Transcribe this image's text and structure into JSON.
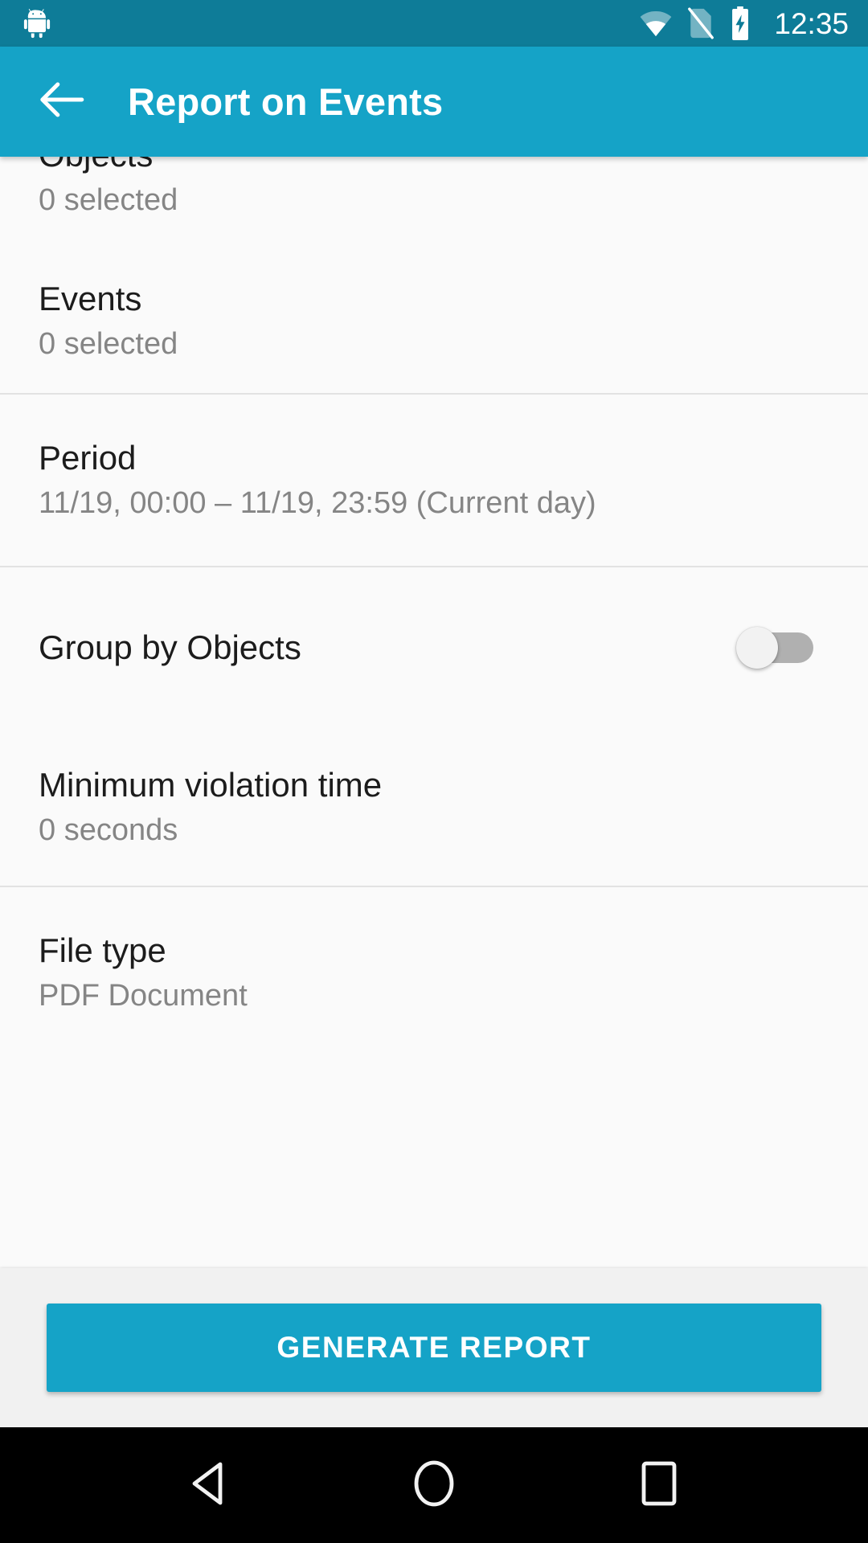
{
  "status_bar": {
    "notification_icon": "android-robot-icon",
    "icons": [
      "wifi-icon",
      "no-sim-card-icon",
      "battery-charging-icon"
    ],
    "time": "12:35",
    "background_color": "#0e7c98"
  },
  "app_bar": {
    "back_icon": "arrow-left-icon",
    "title": "Report on Events",
    "background_color": "#15a3c7"
  },
  "settings_rows": [
    {
      "title": "Objects",
      "subtitle": "0 selected"
    },
    {
      "title": "Events",
      "subtitle": "0 selected"
    },
    {
      "title": "Period",
      "subtitle": "11/19, 00:00 – 11/19, 23:59 (Current day)"
    },
    {
      "title": "Group by Objects",
      "subtitle": "",
      "toggle": "off"
    },
    {
      "title": "Minimum violation time",
      "subtitle": "0 seconds"
    },
    {
      "title": "File type",
      "subtitle": "PDF Document"
    }
  ],
  "action_bar": {
    "generate_label": "GENERATE REPORT",
    "button_color": "#15a3c7"
  },
  "nav_bar": {
    "back": "nav-back-icon",
    "home": "nav-home-icon",
    "recents": "nav-recents-icon"
  }
}
